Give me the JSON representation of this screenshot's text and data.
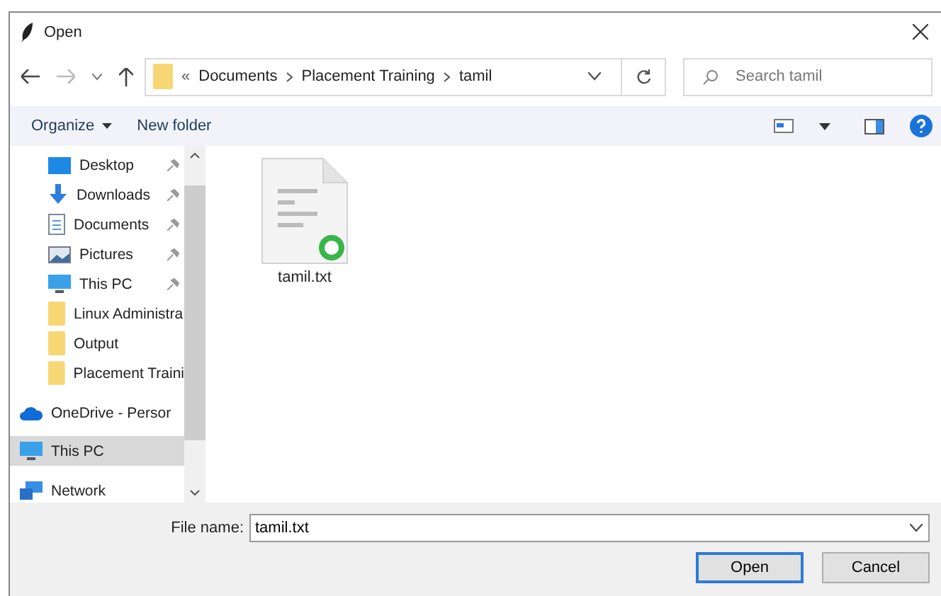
{
  "window": {
    "title": "Open"
  },
  "address": {
    "overflow": "«",
    "crumbs": [
      "Documents",
      "Placement Training",
      "tamil"
    ]
  },
  "search": {
    "placeholder": "Search tamil"
  },
  "toolbar": {
    "organize": "Organize",
    "new_folder": "New folder"
  },
  "sidebar": {
    "items": [
      {
        "kind": "desktop",
        "label": "Desktop",
        "pinned": true,
        "selected": false
      },
      {
        "kind": "downloads",
        "label": "Downloads",
        "pinned": true,
        "selected": false
      },
      {
        "kind": "documents",
        "label": "Documents",
        "pinned": true,
        "selected": false
      },
      {
        "kind": "pictures",
        "label": "Pictures",
        "pinned": true,
        "selected": false
      },
      {
        "kind": "pc",
        "label": "This PC",
        "pinned": true,
        "selected": false
      },
      {
        "kind": "folder",
        "label": "Linux Administra",
        "pinned": false,
        "selected": false
      },
      {
        "kind": "folder",
        "label": "Output",
        "pinned": false,
        "selected": false
      },
      {
        "kind": "folder",
        "label": "Placement Traini",
        "pinned": false,
        "selected": false
      },
      {
        "kind": "onedrive",
        "label": "OneDrive - Persor",
        "pinned": false,
        "selected": false
      },
      {
        "kind": "pc",
        "label": "This PC",
        "pinned": false,
        "selected": true
      },
      {
        "kind": "network",
        "label": "Network",
        "pinned": false,
        "selected": false
      }
    ]
  },
  "files": [
    {
      "name": "tamil.txt"
    }
  ],
  "filename": {
    "label": "File name:",
    "value": "tamil.txt"
  },
  "buttons": [
    {
      "label": "Open",
      "default": true
    },
    {
      "label": "Cancel",
      "default": false
    }
  ]
}
